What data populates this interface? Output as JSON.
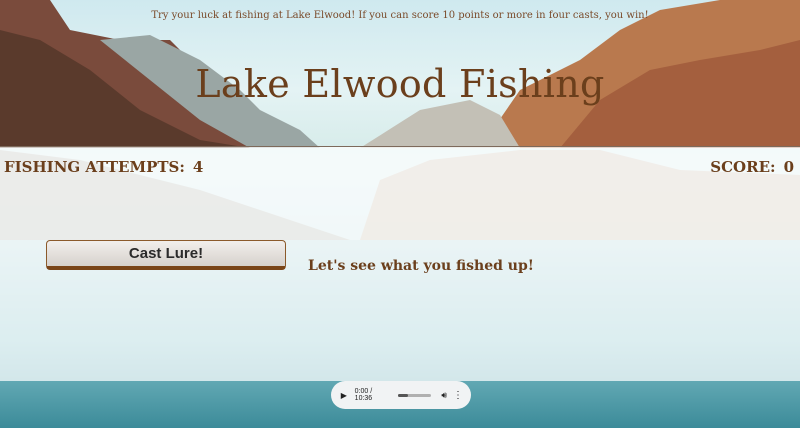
{
  "header": {
    "instructions": "Try your luck at fishing at Lake Elwood! If you can score 10 points or more in four casts, you win!",
    "title": "Lake Elwood Fishing"
  },
  "stats": {
    "attempts_label": "FISHING ATTEMPTS:",
    "attempts_value": "4",
    "score_label": "SCORE:",
    "score_value": "0"
  },
  "actions": {
    "cast_label": "Cast Lure!"
  },
  "result_text": "Let's see what you fished up!",
  "audio": {
    "time": "0:00 / 10:36",
    "progress": 0.0,
    "play_icon": "play-icon",
    "volume_icon": "volume-icon",
    "more_icon": "more-icon"
  },
  "colors": {
    "text_brown": "#6b3f1c",
    "button_border": "#8b5a2b"
  }
}
